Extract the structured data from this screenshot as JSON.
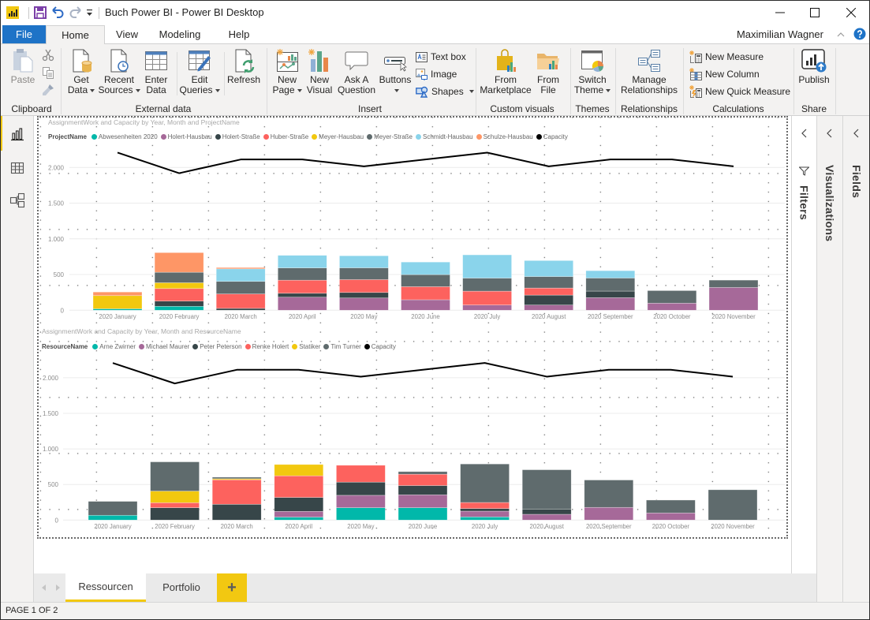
{
  "window": {
    "title": "Buch Power BI - Power BI Desktop",
    "quick_access": [
      "save-icon",
      "undo-icon",
      "redo-icon",
      "customize-quick-access-icon"
    ],
    "controls": [
      "minimize",
      "maximize",
      "close"
    ]
  },
  "menu_tabs": [
    "File",
    "Home",
    "View",
    "Modeling",
    "Help"
  ],
  "active_menu_tab": "Home",
  "user": {
    "name": "Maximilian Wagner"
  },
  "ribbon": {
    "clipboard": {
      "label": "Clipboard",
      "paste": "Paste",
      "small": [
        "cut-icon",
        "copy-icon",
        "format-painter-icon"
      ]
    },
    "external_data": {
      "label": "External data",
      "get_data": [
        "Get",
        "Data"
      ],
      "recent_sources": [
        "Recent",
        "Sources"
      ],
      "enter_data": [
        "Enter",
        "Data"
      ],
      "edit_queries": [
        "Edit",
        "Queries"
      ],
      "refresh": "Refresh"
    },
    "insert": {
      "label": "Insert",
      "new_page": [
        "New",
        "Page"
      ],
      "new_visual": [
        "New",
        "Visual"
      ],
      "ask_question": [
        "Ask A",
        "Question"
      ],
      "buttons": "Buttons",
      "text_box": "Text box",
      "image": "Image",
      "shapes": "Shapes"
    },
    "custom_visuals": {
      "label": "Custom visuals",
      "from_marketplace": [
        "From",
        "Marketplace"
      ],
      "from_file": [
        "From",
        "File"
      ]
    },
    "themes": {
      "label": "Themes",
      "switch_theme": [
        "Switch",
        "Theme"
      ]
    },
    "relationships": {
      "label": "Relationships",
      "manage_relationships": [
        "Manage",
        "Relationships"
      ]
    },
    "calculations": {
      "label": "Calculations",
      "new_measure": "New Measure",
      "new_column": "New Column",
      "new_quick_measure": "New Quick Measure"
    },
    "share": {
      "label": "Share",
      "publish": "Publish"
    }
  },
  "views": [
    {
      "icon": "report-view-icon",
      "active": true
    },
    {
      "icon": "data-view-icon",
      "active": false
    },
    {
      "icon": "model-view-icon",
      "active": false
    }
  ],
  "panes": {
    "filters": "Filters",
    "visualizations": "Visualizations",
    "fields": "Fields"
  },
  "page_tabs": [
    {
      "label": "Ressourcen",
      "active": true
    },
    {
      "label": "Portfolio",
      "active": false
    }
  ],
  "add_page_label": "+",
  "status": {
    "page_indicator": "PAGE 1 OF 2"
  },
  "colors": {
    "accent_yellow": "#F2C811",
    "file_tab_blue": "#1E73C7"
  },
  "chart_data": [
    {
      "type": "bar",
      "stacked": true,
      "title": "AssignmentWork and Capacity by Year, Month and ProjectName",
      "legend_title": "ProjectName",
      "legend_position": "top-left",
      "xlabel": "",
      "ylabel": "",
      "grid": true,
      "ylim": [
        0,
        2250
      ],
      "yticks": [
        0,
        500,
        1000,
        1500,
        2000
      ],
      "ytick_labels": [
        "0",
        "500",
        "1.000",
        "1.500",
        "2.000"
      ],
      "categories": [
        "2020 January",
        "2020 February",
        "2020 March",
        "2020 April",
        "2020 May",
        "2020 June",
        "2020 July",
        "2020 August",
        "2020 September",
        "2020 October",
        "2020 November"
      ],
      "series": [
        {
          "name": "Abwesenheiten 2020",
          "type": "bar",
          "color": "#01B8AA",
          "values": [
            20,
            55,
            0,
            0,
            0,
            0,
            0,
            0,
            0,
            0,
            0
          ]
        },
        {
          "name": "Holert-Hausbau",
          "type": "bar",
          "color": "#A66999",
          "values": [
            0,
            0,
            0,
            183,
            172,
            147,
            73,
            73,
            176,
            99,
            319
          ]
        },
        {
          "name": "Holert-Straße",
          "type": "bar",
          "color": "#374649",
          "values": [
            0,
            73,
            26,
            55,
            77,
            0,
            0,
            139,
            92,
            0,
            0
          ]
        },
        {
          "name": "Huber-Straße",
          "type": "bar",
          "color": "#FD625E",
          "values": [
            0,
            176,
            202,
            183,
            180,
            183,
            194,
            99,
            0,
            0,
            0
          ]
        },
        {
          "name": "Meyer-Hausbau",
          "type": "bar",
          "color": "#F2C80F",
          "values": [
            185,
            81,
            0,
            0,
            0,
            0,
            0,
            0,
            0,
            0,
            0
          ]
        },
        {
          "name": "Meyer-Straße",
          "type": "bar",
          "color": "#5F6B6D",
          "values": [
            0,
            147,
            176,
            172,
            165,
            169,
            183,
            161,
            183,
            176,
            103
          ]
        },
        {
          "name": "Schmidt-Hausbau",
          "type": "bar",
          "color": "#8AD4EB",
          "values": [
            0,
            0,
            176,
            176,
            169,
            176,
            326,
            224,
            103,
            0,
            0
          ]
        },
        {
          "name": "Schulze-Hausbau",
          "type": "bar",
          "color": "#FE9666",
          "values": [
            50,
            275,
            18,
            0,
            0,
            0,
            0,
            0,
            0,
            0,
            0
          ]
        },
        {
          "name": "Capacity",
          "type": "line",
          "color": "#000000",
          "values": [
            2208,
            1920,
            2112,
            2112,
            2016,
            2112,
            2208,
            2016,
            2112,
            2112,
            2016
          ]
        }
      ]
    },
    {
      "type": "bar",
      "stacked": true,
      "title": "AssignmentWork and Capacity by Year, Month and ResourceName",
      "legend_title": "ResourceName",
      "legend_position": "top-left",
      "xlabel": "",
      "ylabel": "",
      "grid": true,
      "ylim": [
        0,
        2250
      ],
      "yticks": [
        0,
        500,
        1000,
        1500,
        2000
      ],
      "ytick_labels": [
        "0",
        "500",
        "1.000",
        "1.500",
        "2.000"
      ],
      "categories": [
        "2020 January",
        "2020 February",
        "2020 March",
        "2020 April",
        "2020 May",
        "2020 June",
        "2020 July",
        "2020 August",
        "2020 September",
        "2020 October",
        "2020 November"
      ],
      "series": [
        {
          "name": "Arne Zwirner",
          "type": "bar",
          "color": "#01B8AA",
          "values": [
            67,
            0,
            0,
            41,
            174,
            174,
            44,
            0,
            0,
            0,
            0
          ]
        },
        {
          "name": "Michael Maurer",
          "type": "bar",
          "color": "#A66999",
          "values": [
            0,
            0,
            0,
            81,
            174,
            181,
            81,
            81,
            178,
            100,
            0
          ]
        },
        {
          "name": "Peter Peterson",
          "type": "bar",
          "color": "#374649",
          "values": [
            0,
            174,
            222,
            196,
            185,
            130,
            37,
            74,
            0,
            0,
            0
          ]
        },
        {
          "name": "Renke Holert",
          "type": "bar",
          "color": "#FD625E",
          "values": [
            0,
            70,
            344,
            304,
            237,
            159,
            85,
            0,
            0,
            0,
            0
          ]
        },
        {
          "name": "Statiker",
          "type": "bar",
          "color": "#F2C80F",
          "values": [
            0,
            163,
            15,
            159,
            0,
            0,
            0,
            0,
            0,
            0,
            0
          ]
        },
        {
          "name": "Tim Turner",
          "type": "bar",
          "color": "#5F6B6D",
          "values": [
            196,
            411,
            22,
            0,
            0,
            37,
            541,
            552,
            385,
            181,
            426
          ]
        },
        {
          "name": "Capacity",
          "type": "line",
          "color": "#000000",
          "values": [
            2208,
            1920,
            2112,
            2112,
            2016,
            2112,
            2208,
            2016,
            2112,
            2112,
            2016
          ]
        }
      ]
    }
  ]
}
